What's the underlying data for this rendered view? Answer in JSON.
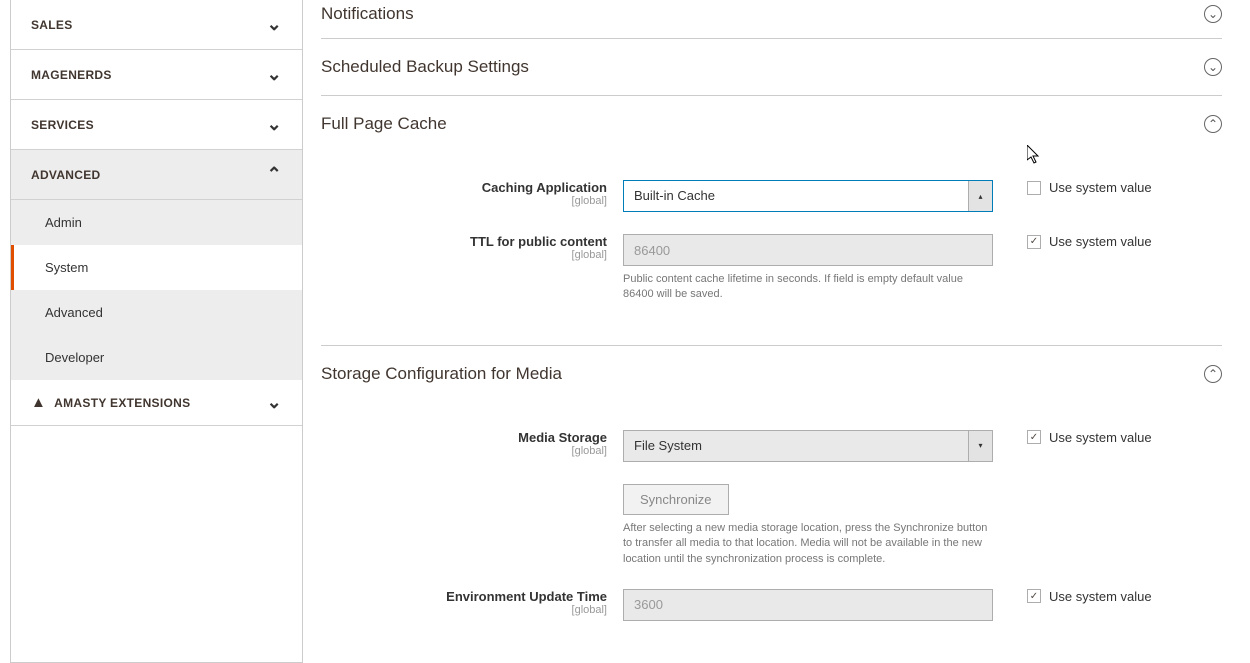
{
  "sidebar": {
    "items": [
      {
        "label": "SALES",
        "expanded": false
      },
      {
        "label": "MAGENERDS",
        "expanded": false
      },
      {
        "label": "SERVICES",
        "expanded": false
      },
      {
        "label": "ADVANCED",
        "expanded": true,
        "children": [
          {
            "label": "Admin",
            "active": false
          },
          {
            "label": "System",
            "active": true
          },
          {
            "label": "Advanced",
            "active": false
          },
          {
            "label": "Developer",
            "active": false
          }
        ]
      },
      {
        "label": "AMASTY EXTENSIONS",
        "expanded": false,
        "icon": true
      }
    ]
  },
  "sections": {
    "notifications": {
      "title": "Notifications"
    },
    "scheduled_backup": {
      "title": "Scheduled Backup Settings"
    },
    "full_page_cache": {
      "title": "Full Page Cache",
      "caching_app": {
        "label": "Caching Application",
        "scope": "[global]",
        "value": "Built-in Cache",
        "use_sys": "Use system value",
        "checked": false
      },
      "ttl": {
        "label": "TTL for public content",
        "scope": "[global]",
        "value": "86400",
        "use_sys": "Use system value",
        "checked": true,
        "hint": "Public content cache lifetime in seconds. If field is empty default value 86400 will be saved."
      }
    },
    "storage": {
      "title": "Storage Configuration for Media",
      "media_storage": {
        "label": "Media Storage",
        "scope": "[global]",
        "value": "File System",
        "use_sys": "Use system value",
        "checked": true
      },
      "sync_btn": "Synchronize",
      "sync_hint": "After selecting a new media storage location, press the Synchronize button to transfer all media to that location. Media will not be available in the new location until the synchronization process is complete.",
      "env_update": {
        "label": "Environment Update Time",
        "scope": "[global]",
        "value": "3600",
        "use_sys": "Use system value",
        "checked": true
      }
    }
  }
}
